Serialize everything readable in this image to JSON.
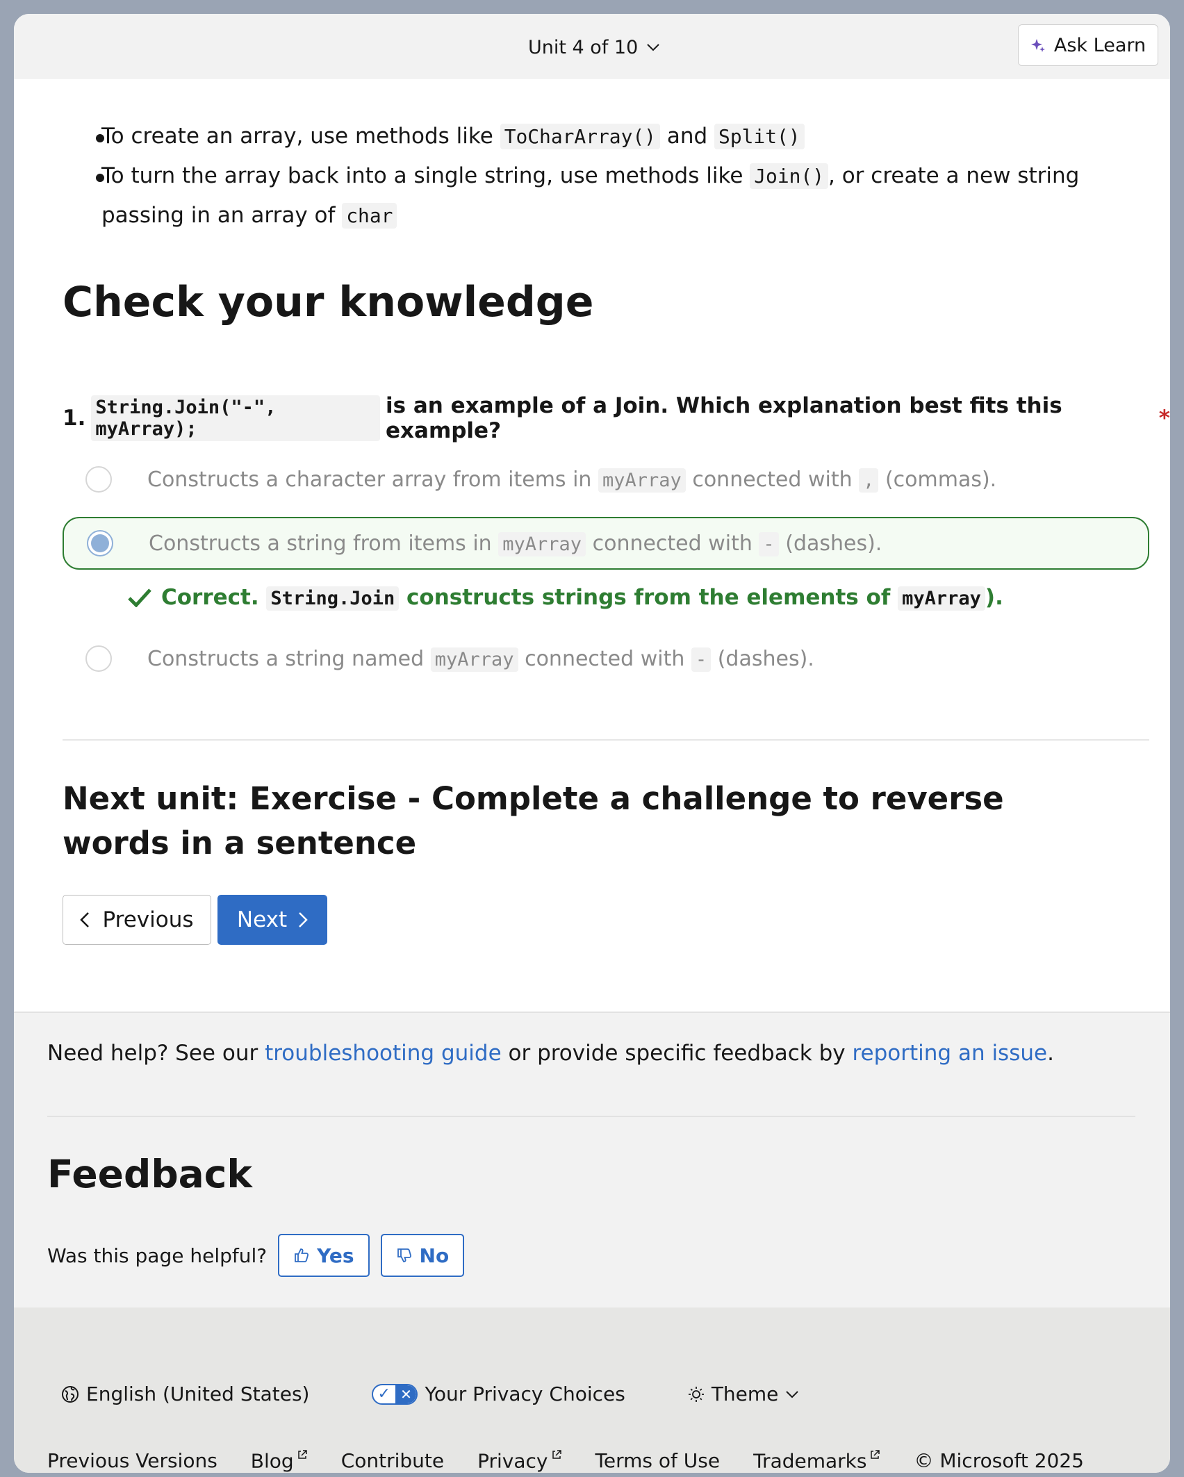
{
  "topbar": {
    "unit_label": "Unit 4 of 10",
    "ask_learn_label": "Ask Learn"
  },
  "summary": {
    "item1": {
      "prefix": "To create an array, use methods like",
      "code1": "ToCharArray()",
      "middle": "and",
      "code2": "Split()"
    },
    "item2": {
      "prefix": "To turn the array back into a single string, use methods like",
      "code1": "Join()",
      "suffix": ", or create a new string passing in an array of",
      "code2": "char"
    }
  },
  "knowledge": {
    "heading": "Check your knowledge",
    "question": {
      "number": "1.",
      "code": "String.Join(\"-\", myArray);",
      "text": "is an example of a Join. Which explanation best fits this example?",
      "required_mark": "*"
    },
    "options": [
      {
        "prefix": "Constructs a character array from items in",
        "code1": "myArray",
        "middle": "connected with",
        "code2": ",",
        "suffix": "(commas).",
        "selected": false
      },
      {
        "prefix": "Constructs a string from items in",
        "code1": "myArray",
        "middle": "connected with",
        "code2": "-",
        "suffix": "(dashes).",
        "selected": true
      },
      {
        "prefix": "Constructs a string named",
        "code1": "myArray",
        "middle": "connected with",
        "code2": "-",
        "suffix": "(dashes).",
        "selected": false
      }
    ],
    "feedback": {
      "status": "Correct.",
      "code1": "String.Join",
      "text": "constructs strings from the elements of",
      "code2": "myArray",
      "suffix": ")."
    }
  },
  "next_unit": {
    "title": "Next unit: Exercise - Complete a challenge to reverse words in a sentence",
    "previous_label": "Previous",
    "next_label": "Next"
  },
  "help": {
    "prefix": "Need help? See our",
    "link1": "troubleshooting guide",
    "middle": "or provide specific feedback by",
    "link2": "reporting an issue",
    "suffix": "."
  },
  "feedback": {
    "heading": "Feedback",
    "question": "Was this page helpful?",
    "yes_label": "Yes",
    "no_label": "No"
  },
  "footer": {
    "locale": "English (United States)",
    "privacy": "Your Privacy Choices",
    "theme": "Theme",
    "links": {
      "previous_versions": "Previous Versions",
      "blog": "Blog",
      "contribute": "Contribute",
      "privacy": "Privacy",
      "terms": "Terms of Use",
      "trademarks": "Trademarks",
      "copyright": "© Microsoft 2025"
    }
  },
  "colors": {
    "accent": "#2f6cc4",
    "success": "#2e7d32",
    "required": "#c62828"
  }
}
